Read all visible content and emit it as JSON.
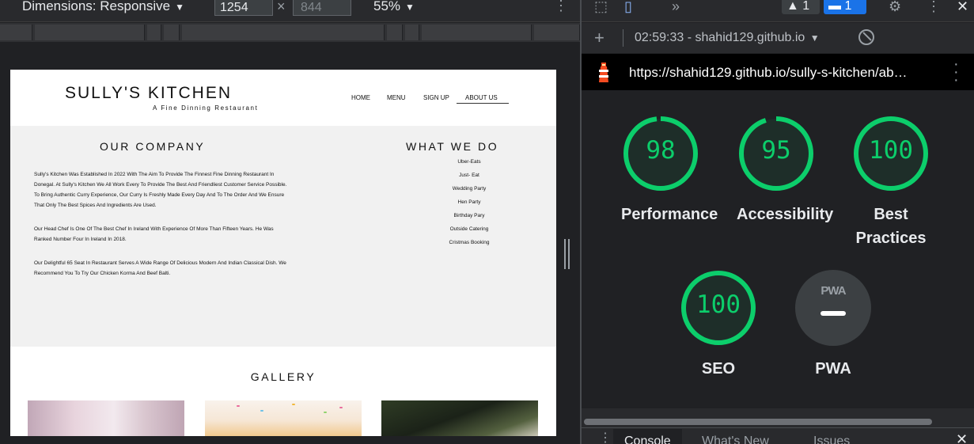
{
  "device_toolbar": {
    "dimensions_label": "Dimensions: Responsive",
    "width_value": "1254",
    "height_placeholder": "844",
    "times": "×",
    "zoom": "55%"
  },
  "site": {
    "brand": "SULLY'S KITCHEN",
    "tagline": "A Fine Dinning Restaurant",
    "nav": [
      "HOME",
      "MENU",
      "SIGN UP",
      "ABOUT US"
    ],
    "active_nav": "ABOUT US",
    "company_heading": "OUR COMPANY",
    "paragraphs": [
      "Sully's Kitchen Was Established In 2022 With The Aim To Provide The Finnest Fine Dinning Restaurant In Donegal. At Sully's Kitchen We All Work Every To Provide The Best And Friendliest Customer Service Possible. To Bring Authentic Curry Experience, Our Curry Is Freshly Made Every Day And To The Order And We Ensure That Only The Best Spices And Ingredients Are Used.",
      "Our Head Chef Is One Of The Best Chef In Ireland With Experience Of More Than Fifteen Years. He Was Ranked Number Four In Ireland In 2018.",
      "Our Delightful 65 Seat In Restaurant Serves A Wide Range Of Delicious Modern And Indian Classical Dish. We Recommend You To Try Our Chicken Korma And Beef Balti."
    ],
    "what_we_do_heading": "WHAT WE DO",
    "services": [
      "Uber-Eats",
      "Just- Eat",
      "Wedding Party",
      "Hen Party",
      "Birthday Pary",
      "Outside Catering",
      "Cristmas Booking"
    ],
    "gallery_heading": "GALLERY"
  },
  "devtools": {
    "warnings_count": "1",
    "messages_count": "1",
    "report_time": "02:59:33 - shahid129.github.io",
    "report_url": "https://shahid129.github.io/sully-s-kitchen/ab…",
    "scores": [
      {
        "score": 98,
        "label": "Performance"
      },
      {
        "score": 95,
        "label": "Accessibility"
      },
      {
        "score": 100,
        "label": "Best Practices"
      },
      {
        "score": 100,
        "label": "SEO"
      }
    ],
    "pwa_badge_text": "PWA",
    "pwa_label": "PWA",
    "score_color": "#0cce6b",
    "drawer_tabs": [
      "Console",
      "What's New",
      "Issues"
    ]
  }
}
